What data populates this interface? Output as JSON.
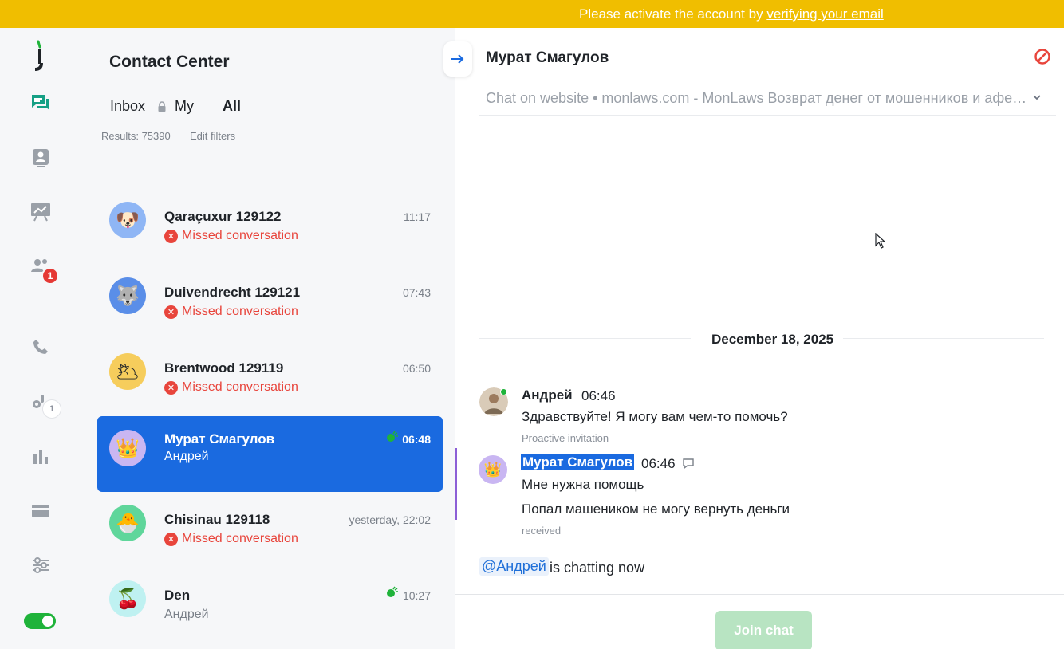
{
  "banner": {
    "text": "Please activate the account by ",
    "link_text": "verifying your email",
    "bg_color": "#f0be00"
  },
  "rail": {
    "items": [
      {
        "name": "chats-icon",
        "active": true
      },
      {
        "name": "contacts-icon"
      },
      {
        "name": "reports-board-icon"
      },
      {
        "name": "team-icon",
        "badge": "1"
      },
      {
        "name": "phone-icon"
      },
      {
        "name": "integrations-icon",
        "badge": "1"
      },
      {
        "name": "analytics-icon"
      },
      {
        "name": "billing-card-icon"
      },
      {
        "name": "settings-sliders-icon"
      }
    ],
    "online_toggle": true
  },
  "list": {
    "title": "Contact Center",
    "tabs": [
      {
        "label": "Inbox",
        "locked": true
      },
      {
        "label": "My"
      },
      {
        "label": "All",
        "active": true
      }
    ],
    "results": "Results: 75390",
    "edit_filters": "Edit filters",
    "conversations": [
      {
        "name": "Qaraçuxur 129122",
        "time": "11:17",
        "status": "Missed conversation",
        "avatar": "🐶",
        "avatar_bg": "#8fb6f5"
      },
      {
        "name": "Duivendrecht 129121",
        "time": "07:43",
        "status": "Missed conversation",
        "avatar": "🐺",
        "avatar_bg": "#5a8ee8"
      },
      {
        "name": "Brentwood 129119",
        "time": "06:50",
        "status": "Missed conversation",
        "avatar": "🌥",
        "avatar_bg": "#f6cd5c"
      },
      {
        "name": "Мурат Смагулов",
        "time": "06:48",
        "status": "Андрей",
        "avatar": "👑",
        "avatar_bg": "#c9b6f2",
        "selected": true
      },
      {
        "name": "Chisinau 129118",
        "time": "yesterday, 22:02",
        "status": "Missed conversation",
        "avatar": "🐣",
        "avatar_bg": "#5fd69b"
      },
      {
        "name": "Den",
        "time": "10:27",
        "status": "Андрей",
        "avatar": "🍒",
        "avatar_bg": "#bff1f1"
      }
    ]
  },
  "chat": {
    "title": "Мурат Смагулов",
    "source": "Chat on website • monlaws.com - MonLaws Возврат денег от мошенников и аферистов",
    "date": "December 18, 2025",
    "messages": [
      {
        "author": "Андрей",
        "time": "06:46",
        "lines": [
          "Здравствуйте! Я могу вам чем-то помочь?"
        ],
        "meta": "Proactive invitation"
      },
      {
        "author": "Мурат Смагулов",
        "time": "06:46",
        "lines": [
          "Мне нужна помощь",
          "Попал машеником не могу вернуть деньги"
        ],
        "meta": "received"
      }
    ],
    "mention": "@Андрей",
    "chatting_now": "is chatting now",
    "join_button": "Join chat"
  }
}
